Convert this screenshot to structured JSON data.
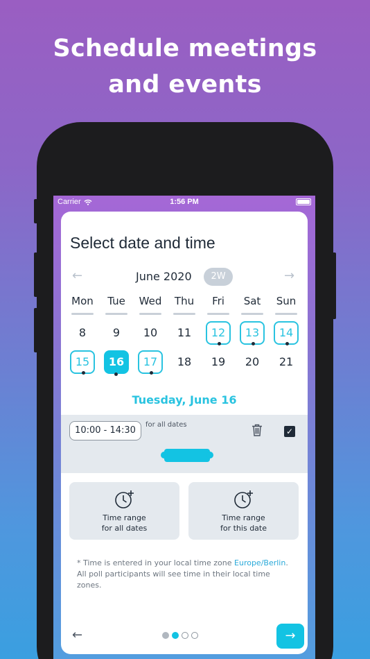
{
  "promo": {
    "line1": "Schedule meetings",
    "line2": "and events"
  },
  "status_bar": {
    "carrier": "Carrier",
    "time": "1:56 PM"
  },
  "screen": {
    "title": "Select date and time",
    "calendar": {
      "month": "June 2020",
      "view_toggle": "2W",
      "prev_icon": "arrow-left-icon",
      "next_icon": "arrow-right-icon",
      "weekdays": [
        "Mon",
        "Tue",
        "Wed",
        "Thu",
        "Fri",
        "Sat",
        "Sun"
      ],
      "week1": [
        "8",
        "9",
        "10",
        "11",
        "12",
        "13",
        "14"
      ],
      "week2": [
        "15",
        "16",
        "17",
        "18",
        "19",
        "20",
        "21"
      ],
      "marked_days": [
        "12",
        "13",
        "14",
        "15",
        "17"
      ],
      "selected_day": "16"
    },
    "selected_date_label": "Tuesday, June 16",
    "time_slot": {
      "range": "10:00 - 14:30",
      "scope": "for all dates",
      "checked": true
    },
    "options": {
      "all_dates": {
        "line1": "Time range",
        "line2": "for all dates",
        "icon": "clock-plus-icon"
      },
      "this_date": {
        "line1": "Time range",
        "line2": "for this date",
        "icon": "clock-plus-icon"
      }
    },
    "note": {
      "prefix": "* Time is entered in your local time zone ",
      "timezone": "Europe/Berlin",
      "suffix": ". All poll participants will see time in their local time zones."
    },
    "pager": {
      "total": 4,
      "active": 2
    },
    "colors": {
      "accent": "#13c3e3",
      "text": "#1f2a37",
      "panel": "#e4e9ee"
    }
  }
}
